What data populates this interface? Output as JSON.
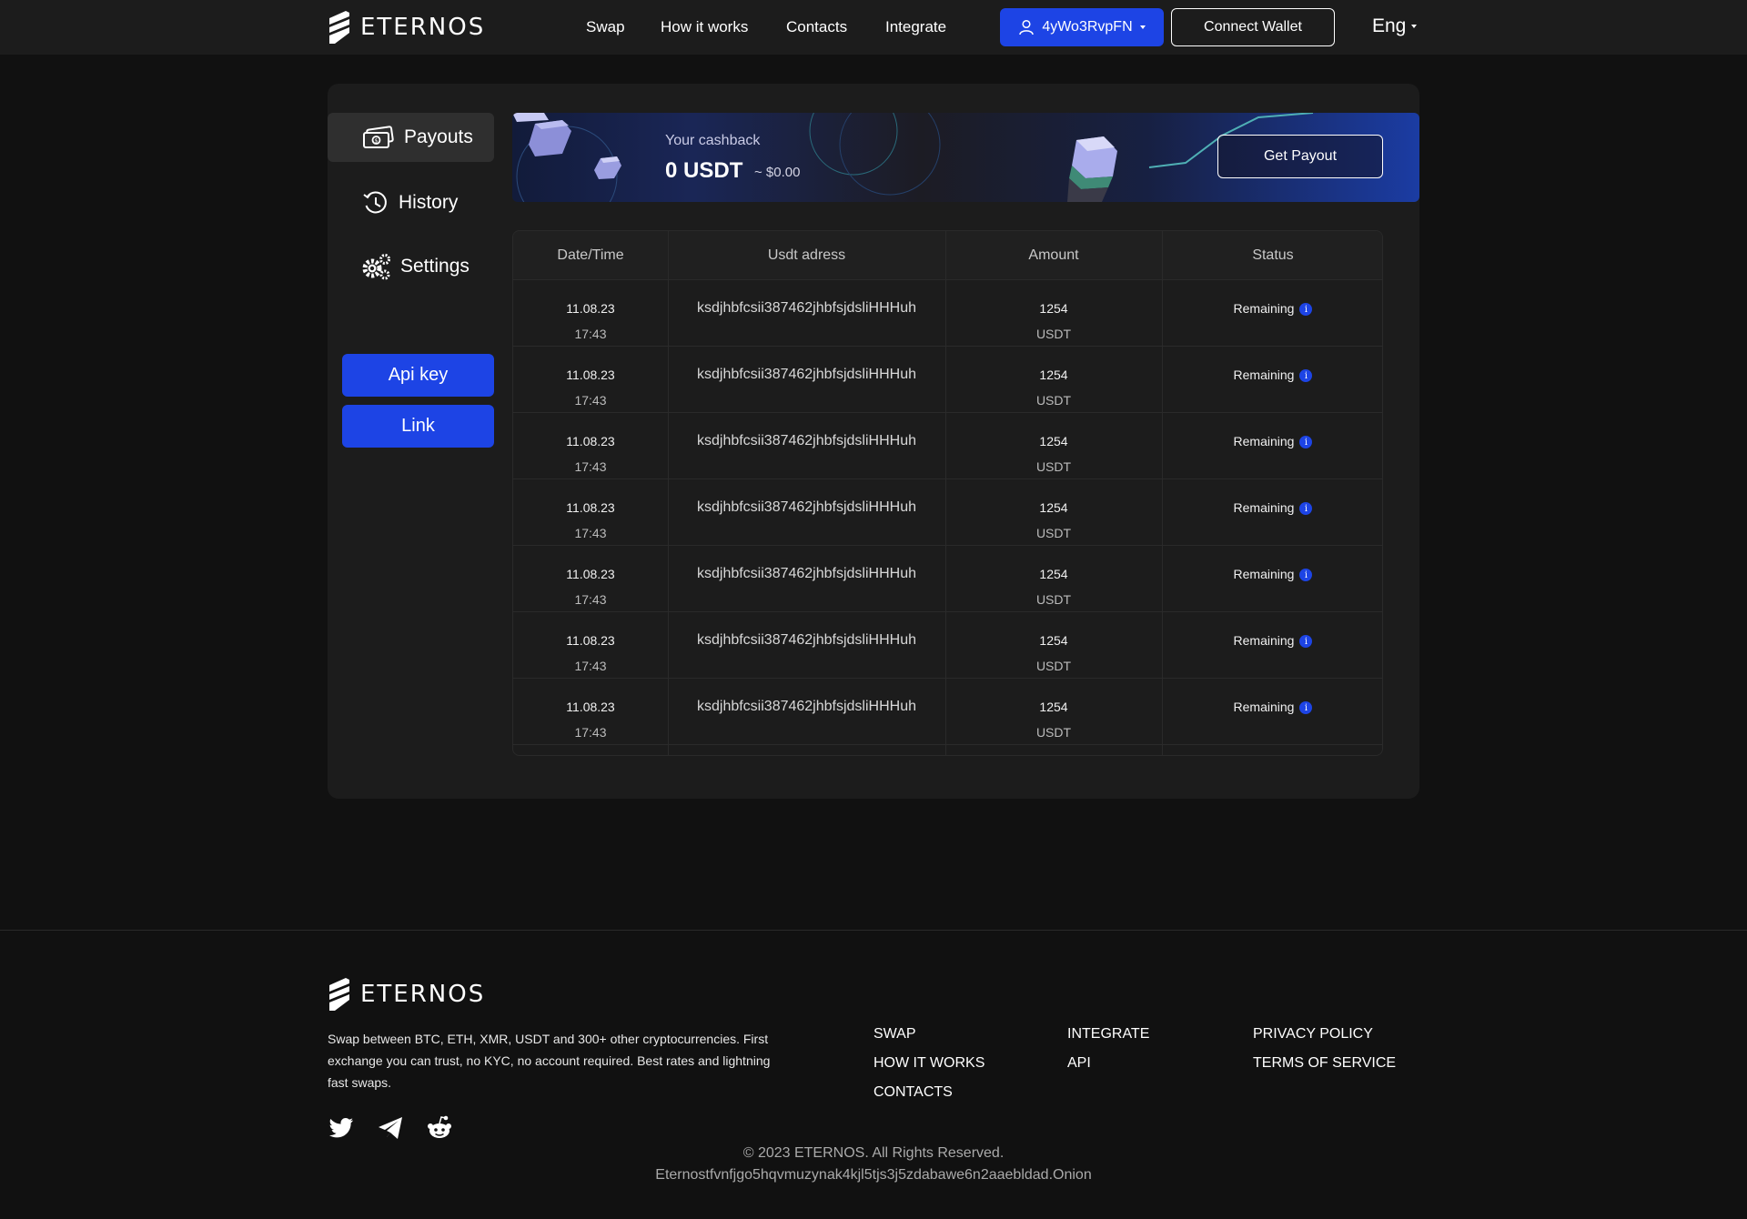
{
  "brand": {
    "name": "ETERNOS"
  },
  "nav": {
    "links": [
      "Swap",
      "How it works",
      "Contacts",
      "Integrate"
    ],
    "user_label": "4yWo3RvpFN",
    "connect_label": "Connect Wallet",
    "language": "Eng"
  },
  "sidebar": {
    "items": [
      {
        "label": "Payouts",
        "icon": "money-icon"
      },
      {
        "label": "History",
        "icon": "history-icon"
      },
      {
        "label": "Settings",
        "icon": "gears-icon"
      }
    ],
    "api_key_label": "Api key",
    "link_label": "Link"
  },
  "cashback": {
    "label": "Your cashback",
    "value": "0 USDT",
    "usd": "~ $0.00",
    "button_label": "Get Payout"
  },
  "table": {
    "headers": [
      "Date/Time",
      "Usdt adress",
      "Amount",
      "Status"
    ],
    "rows": [
      {
        "date": "11.08.23",
        "time": "17:43",
        "address": "ksdjhbfcsii387462jhbfsjdsliHHHuh",
        "amount": "1254",
        "currency": "USDT",
        "status": "Remaining"
      },
      {
        "date": "11.08.23",
        "time": "17:43",
        "address": "ksdjhbfcsii387462jhbfsjdsliHHHuh",
        "amount": "1254",
        "currency": "USDT",
        "status": "Remaining"
      },
      {
        "date": "11.08.23",
        "time": "17:43",
        "address": "ksdjhbfcsii387462jhbfsjdsliHHHuh",
        "amount": "1254",
        "currency": "USDT",
        "status": "Remaining"
      },
      {
        "date": "11.08.23",
        "time": "17:43",
        "address": "ksdjhbfcsii387462jhbfsjdsliHHHuh",
        "amount": "1254",
        "currency": "USDT",
        "status": "Remaining"
      },
      {
        "date": "11.08.23",
        "time": "17:43",
        "address": "ksdjhbfcsii387462jhbfsjdsliHHHuh",
        "amount": "1254",
        "currency": "USDT",
        "status": "Remaining"
      },
      {
        "date": "11.08.23",
        "time": "17:43",
        "address": "ksdjhbfcsii387462jhbfsjdsliHHHuh",
        "amount": "1254",
        "currency": "USDT",
        "status": "Remaining"
      },
      {
        "date": "11.08.23",
        "time": "17:43",
        "address": "ksdjhbfcsii387462jhbfsjdsliHHHuh",
        "amount": "1254",
        "currency": "USDT",
        "status": "Remaining"
      }
    ]
  },
  "footer": {
    "description": "Swap between BTC, ETH, XMR, USDT and 300+ other cryptocurrencies. First exchange you can trust, no KYC, no account required. Best rates and lightning fast swaps.",
    "col1": [
      "SWAP",
      "HOW IT WORKS",
      "CONTACTS"
    ],
    "col2": [
      "INTEGRATE",
      "API"
    ],
    "col3": [
      "PRIVACY POLICY",
      "TERMS OF SERVICE"
    ],
    "social": [
      "twitter-icon",
      "telegram-icon",
      "reddit-icon"
    ],
    "copyright": "© 2023 ETERNOS. All Rights Reserved.",
    "onion": "Eternostfvnfjgo5hqvmuzynak4kjl5tjs3j5zdabawe6n2aaebldad.Onion"
  },
  "colors": {
    "accent": "#1d44e5",
    "background": "#111111",
    "panel": "#1c1c1c"
  }
}
